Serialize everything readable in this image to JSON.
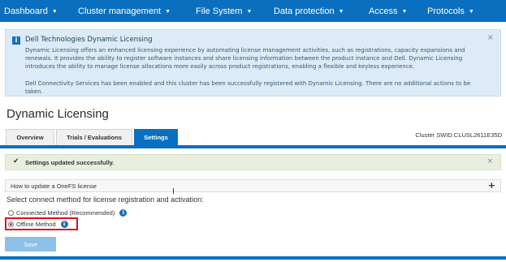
{
  "nav": {
    "items": [
      {
        "label": "Dashboard",
        "icon": "chevron-down-icon"
      },
      {
        "label": "Cluster management",
        "icon": "chevron-down-icon"
      },
      {
        "label": "File System",
        "icon": "chevron-down-icon"
      },
      {
        "label": "Data protection",
        "icon": "chevron-down-icon"
      },
      {
        "label": "Access",
        "icon": "chevron-down-icon"
      },
      {
        "label": "Protocols",
        "icon": "chevron-down-icon"
      }
    ],
    "caret": "▼"
  },
  "info_banner": {
    "icon": "info-icon",
    "icon_glyph": "i",
    "title": "Dell Technologies Dynamic Licensing",
    "body1": "Dynamic Licensing offers an enhanced licensing experience by automating license management activities, such as registrations, capacity expansions and renewals. It provides the ability to register software instances and share licensing information between the product instance and Dell. Dynamic Licensing introduces the ability to manage license allocations more easily across product registrations, enabling a flexible and keyless experience.",
    "body2": "Dell Connectivity Services has been enabled and this cluster has been successfully registered with Dynamic Licensing. There are no additional actions to be taken.",
    "close": "×"
  },
  "page_title": "Dynamic Licensing",
  "tabs": [
    {
      "label": "Overview",
      "active": false
    },
    {
      "label": "Trials / Evaluations",
      "active": false
    },
    {
      "label": "Settings",
      "active": true
    }
  ],
  "cluster_swid": "Cluster SWID:CLUSL2611E35D",
  "success": {
    "check": "✔",
    "text": "Settings updated successfully.",
    "close": "×"
  },
  "accordion": {
    "label": "How to update a OneFS license",
    "plus": "+"
  },
  "cursor": "I",
  "connect_prompt": "Select connect method for license registration and activation:",
  "options": [
    {
      "label": "Connected Method (Recommended)",
      "selected": false,
      "info": "i"
    },
    {
      "label": "Offline Method",
      "selected": true,
      "info": "i"
    }
  ],
  "save_label": "Save",
  "colors": {
    "accent": "#0b6fbf",
    "highlight": "#e0101e",
    "info_bg": "#dcebf7",
    "success_bg": "#e9efdf"
  }
}
